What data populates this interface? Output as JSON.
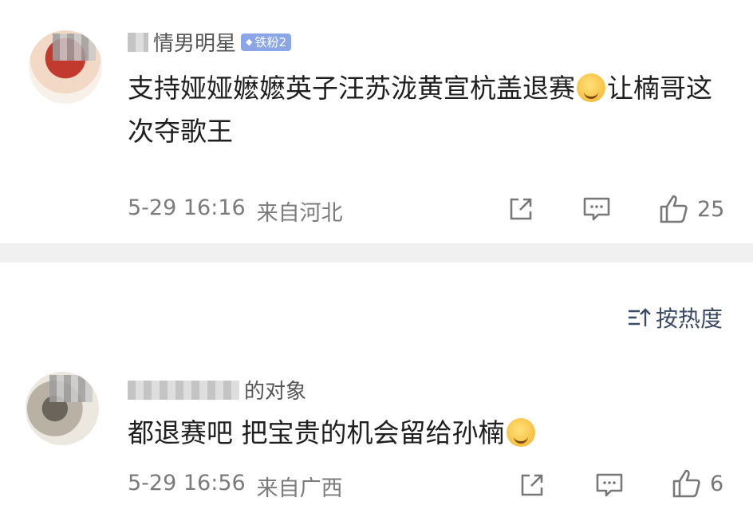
{
  "comments": [
    {
      "username_tail": "情男明星",
      "fan_badge": "铁粉2",
      "text_before_emoji": "支持娅娅嬷嬷英子汪苏泷黄宣杭盖退赛",
      "text_after_emoji": "让楠哥这次夺歌王",
      "emoji": "cute-face-emoji",
      "timestamp": "5-29 16:16",
      "location": "来自河北",
      "likes": "25"
    },
    {
      "username_tail": "的对象",
      "text_before_emoji": "都退赛吧 把宝贵的机会留给孙楠",
      "emoji": "smile-emoji",
      "timestamp": "5-29 16:56",
      "location": "来自广西",
      "likes": "6"
    }
  ],
  "sort": {
    "icon": "sort-icon",
    "label": "按热度"
  },
  "colors": {
    "divider": "#f0f0f0",
    "badge": "#8aa6e6",
    "sort_text": "#3b4a66",
    "meta_text": "#7b7b7b"
  }
}
